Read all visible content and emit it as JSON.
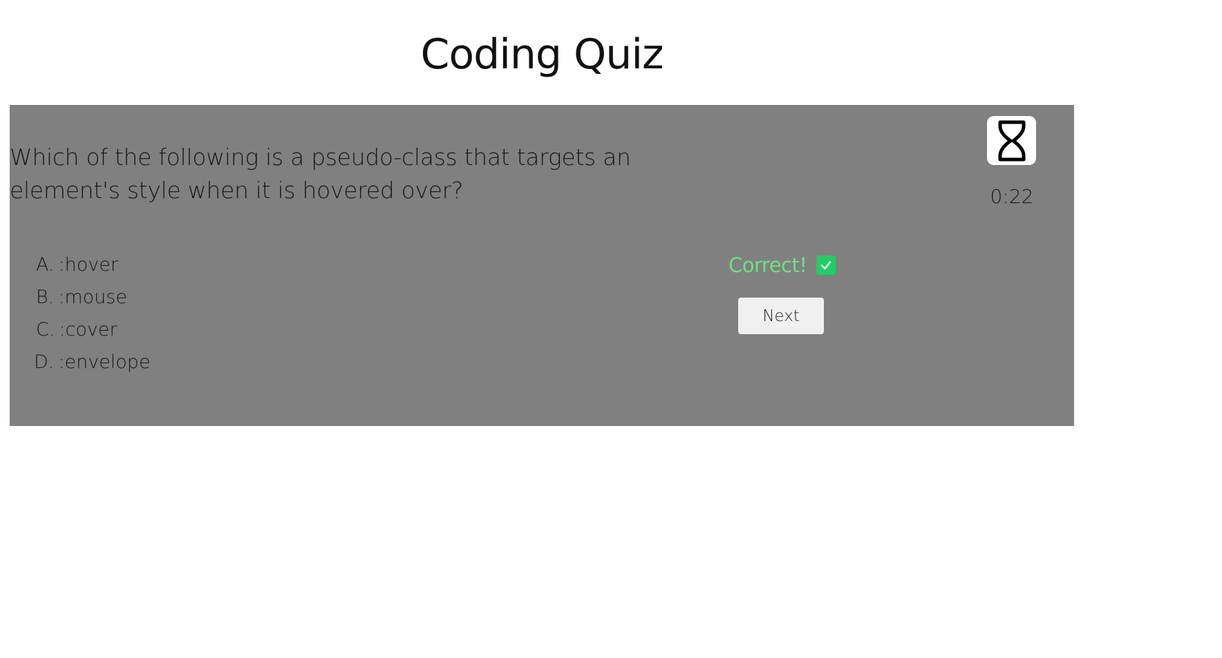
{
  "header": {
    "title": "Coding Quiz"
  },
  "quiz": {
    "question": "Which of the following is a pseudo-class that targets an element's style when it is hovered over?",
    "answers": [
      {
        "letter": "A.",
        "text": ":hover"
      },
      {
        "letter": "B.",
        "text": ":mouse"
      },
      {
        "letter": "C.",
        "text": ":cover"
      },
      {
        "letter": "D.",
        "text": ":envelope"
      }
    ],
    "feedback": {
      "text": "Correct!",
      "icon": "check-icon",
      "color": "#6ee07f",
      "icon_color": "#1fcf63"
    },
    "next_label": "Next"
  },
  "timer": {
    "icon": "hourglass-icon",
    "remaining": "0:22"
  },
  "colors": {
    "card_background": "#808080",
    "page_background": "#ffffff"
  }
}
